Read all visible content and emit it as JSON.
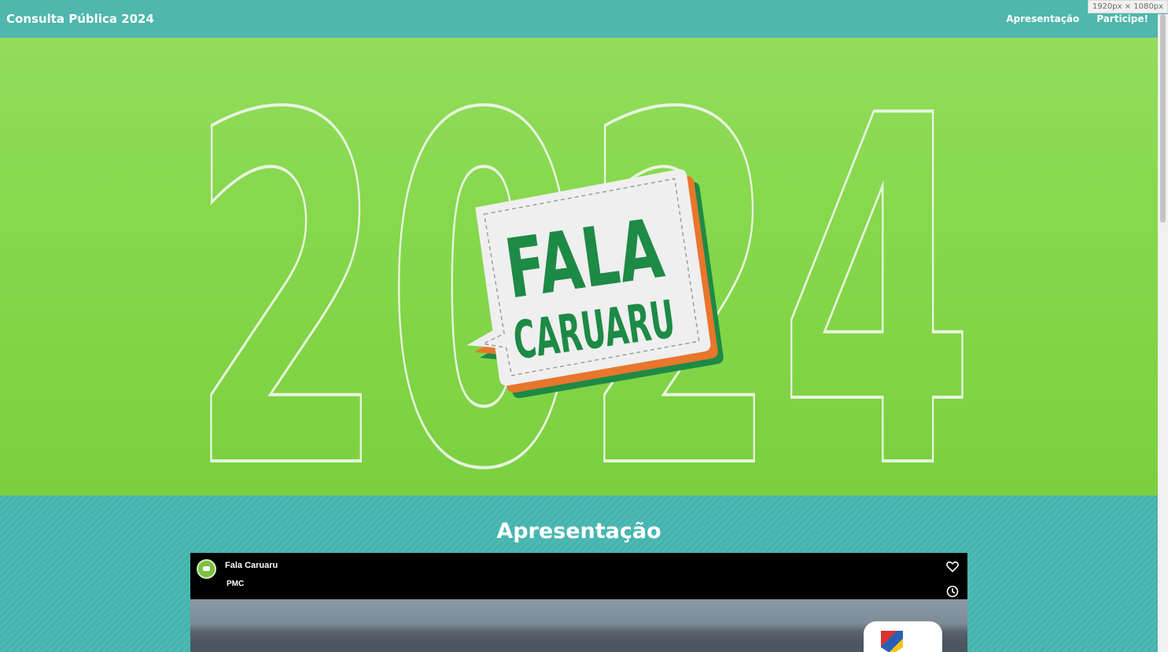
{
  "viewport_badge": "1920px × 1080px",
  "navbar": {
    "brand": "Consulta Pública 2024",
    "links": [
      {
        "label": "Apresentação"
      },
      {
        "label": "Participe!"
      }
    ]
  },
  "hero": {
    "year": "2024",
    "logo_line1": "FALA",
    "logo_line2": "CARUARU",
    "colors": {
      "green": "#1d8a45",
      "orange": "#e8762c",
      "bg": "#86d84c"
    }
  },
  "presentation": {
    "title": "Apresentação",
    "video": {
      "title": "Fala Caruaru",
      "channel": "PMC",
      "icons": [
        "heart-icon",
        "clock-icon",
        "share-icon"
      ]
    }
  }
}
